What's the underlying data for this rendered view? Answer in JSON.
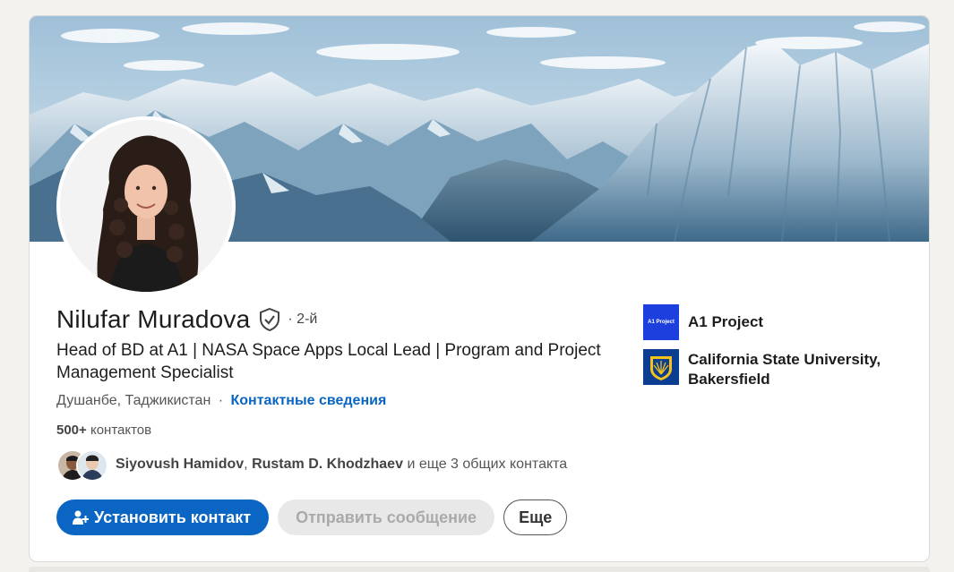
{
  "profile": {
    "name": "Nilufar Muradova",
    "degree": "· 2-й",
    "headline": "Head of BD at A1 | NASA Space Apps Local Lead | Program and Project Management Specialist",
    "location": "Душанбе, Таджикистан",
    "location_sep": "·",
    "contact_info_link": "Контактные сведения",
    "connections_count": "500+",
    "connections_label": "контактов",
    "mutual": {
      "person1": "Siyovush Hamidov",
      "separator": ",",
      "person2": "Rustam D. Khodzhaev",
      "suffix": "и еще 3 общих контакта"
    }
  },
  "actions": {
    "connect_label": "Установить контакт",
    "message_label": "Отправить сообщение",
    "more_label": "Еще"
  },
  "sidebar": {
    "items": [
      {
        "label": "A1 Project",
        "logo_text": "A1 Project"
      },
      {
        "label": "California State University, Bakersfield"
      }
    ]
  },
  "colors": {
    "accent": "#0a66c2",
    "background": "#f4f2ee",
    "a1_logo": "#1d3fdd",
    "csub_logo": "#0b3d91"
  },
  "icons": [
    "verified-shield-icon",
    "add-person-icon",
    "mountain-banner-image",
    "profile-photo"
  ]
}
